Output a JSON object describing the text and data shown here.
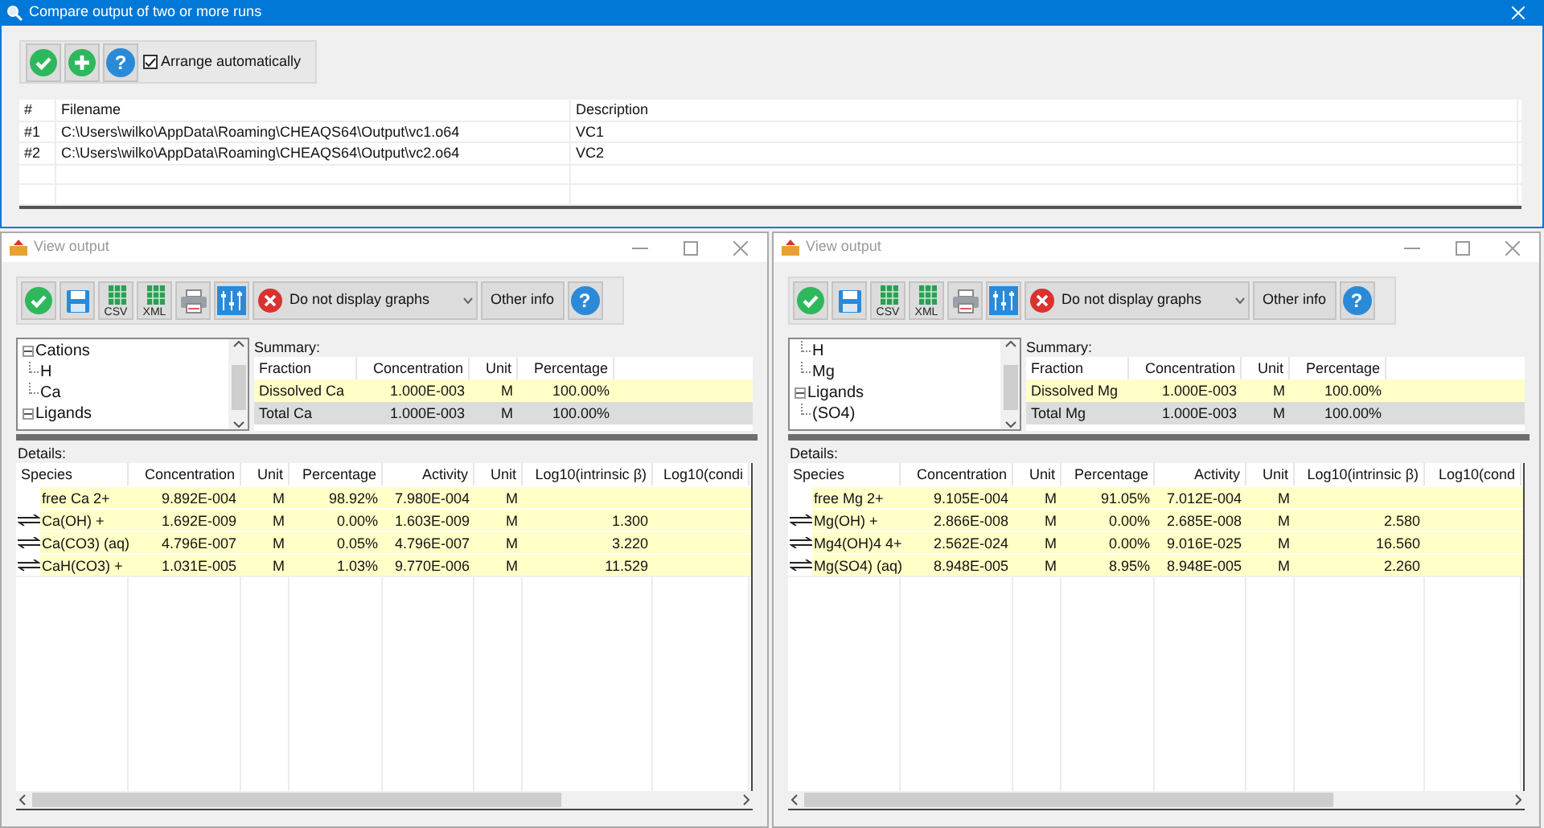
{
  "window": {
    "title": "Compare output of two or more runs"
  },
  "toolbar": {
    "help_label": "?",
    "arrange": {
      "label": "Arrange automatically",
      "checked": true
    }
  },
  "runs_table": {
    "columns": [
      "#",
      "Filename",
      "Description"
    ],
    "rows": [
      {
        "cells": [
          "#1",
          "C:\\Users\\wilko\\AppData\\Roaming\\CHEAQS64\\Output\\vc1.o64",
          "VC1"
        ]
      },
      {
        "cells": [
          "#2",
          "C:\\Users\\wilko\\AppData\\Roaming\\CHEAQS64\\Output\\vc2.o64",
          "VC2"
        ]
      }
    ]
  },
  "output_windows": [
    {
      "title": "View output",
      "csv_label": "CSV",
      "xml_label": "XML",
      "graph_select": "Do not display graphs",
      "other_info": "Other info",
      "help_label": "?",
      "tree": [
        {
          "label": "Cations",
          "expanded": true,
          "children": [
            {
              "label": "H"
            },
            {
              "label": "Ca"
            }
          ]
        },
        {
          "label": "Ligands",
          "expanded": true
        }
      ],
      "summary_label": "Summary:",
      "summary": {
        "columns": [
          "Fraction",
          "Concentration",
          "Unit",
          "Percentage"
        ],
        "rows": [
          {
            "cells": [
              "Dissolved Ca",
              "1.000E-003",
              "M",
              "100.00%"
            ],
            "selected": false
          },
          {
            "cells": [
              "Total Ca",
              "1.000E-003",
              "M",
              "100.00%"
            ],
            "selected": true
          }
        ]
      },
      "details_label": "Details:",
      "details": {
        "columns": [
          "Species",
          "Concentration",
          "Unit",
          "Percentage",
          "Activity",
          "Unit",
          "Log10(intrinsic β)",
          "Log10(condi"
        ],
        "rows": [
          {
            "kind": "free",
            "cells": [
              "free Ca 2+",
              "9.892E-004",
              "M",
              "98.92%",
              "7.980E-004",
              "M"
            ],
            "selected": false
          },
          {
            "kind": "complex",
            "cells": [
              "Ca(OH) +",
              "1.692E-009",
              "M",
              "0.00%",
              "1.603E-009",
              "M",
              "1.300"
            ],
            "selected": false
          },
          {
            "kind": "complex",
            "cells": [
              "Ca(CO3) (aq)",
              "4.796E-007",
              "M",
              "0.05%",
              "4.796E-007",
              "M",
              "3.220"
            ],
            "selected": false
          },
          {
            "kind": "complex",
            "cells": [
              "CaH(CO3) +",
              "1.031E-005",
              "M",
              "1.03%",
              "9.770E-006",
              "M",
              "11.529"
            ],
            "selected": false
          }
        ]
      }
    },
    {
      "title": "View output",
      "csv_label": "CSV",
      "xml_label": "XML",
      "graph_select": "Do not display graphs",
      "other_info": "Other info",
      "help_label": "?",
      "tree": [
        {
          "children": [
            {
              "label": "H"
            },
            {
              "label": "Mg"
            }
          ]
        },
        {
          "label": "Ligands",
          "expanded": true,
          "children": [
            {
              "label": "(SO4)"
            }
          ]
        }
      ],
      "summary_label": "Summary:",
      "summary": {
        "columns": [
          "Fraction",
          "Concentration",
          "Unit",
          "Percentage"
        ],
        "rows": [
          {
            "cells": [
              "Dissolved Mg",
              "1.000E-003",
              "M",
              "100.00%"
            ],
            "selected": false
          },
          {
            "cells": [
              "Total Mg",
              "1.000E-003",
              "M",
              "100.00%"
            ],
            "selected": true
          }
        ]
      },
      "details_label": "Details:",
      "details": {
        "columns": [
          "Species",
          "Concentration",
          "Unit",
          "Percentage",
          "Activity",
          "Unit",
          "Log10(intrinsic β)",
          "Log10(cond"
        ],
        "rows": [
          {
            "kind": "free",
            "cells": [
              "free Mg 2+",
              "9.105E-004",
              "M",
              "91.05%",
              "7.012E-004",
              "M"
            ],
            "selected": false
          },
          {
            "kind": "complex",
            "cells": [
              "Mg(OH) +",
              "2.866E-008",
              "M",
              "0.00%",
              "2.685E-008",
              "M",
              "2.580"
            ],
            "selected": false
          },
          {
            "kind": "complex",
            "cells": [
              "Mg4(OH)4 4+",
              "2.562E-024",
              "M",
              "0.00%",
              "9.016E-025",
              "M",
              "16.560"
            ],
            "selected": false
          },
          {
            "kind": "complex",
            "cells": [
              "Mg(SO4) (aq)",
              "8.948E-005",
              "M",
              "8.95%",
              "8.948E-005",
              "M",
              "2.260"
            ],
            "selected": false
          }
        ]
      }
    }
  ]
}
